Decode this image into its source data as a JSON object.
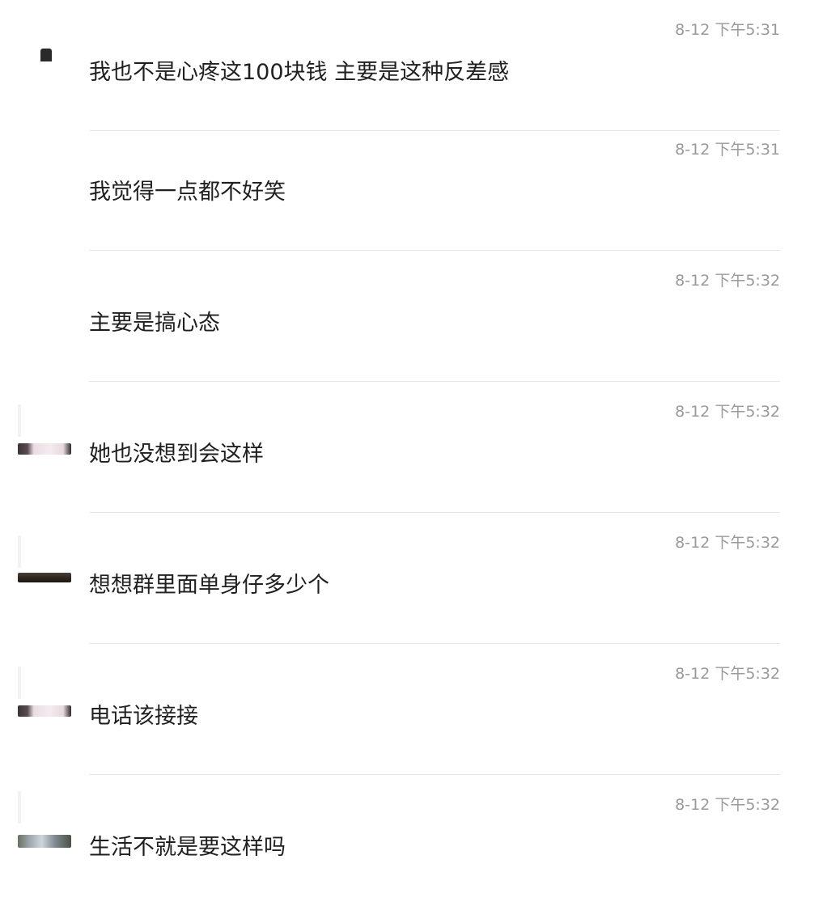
{
  "messages": [
    {
      "time": "8-12 下午5:31",
      "text": "我也不是心疼这100块钱 主要是这种反差感",
      "has_avatar": true
    },
    {
      "time": "8-12 下午5:31",
      "text": "我觉得一点都不好笑",
      "has_avatar": false
    },
    {
      "time": "8-12 下午5:32",
      "text": "主要是搞心态",
      "has_avatar": false
    },
    {
      "time": "8-12 下午5:32",
      "text": "她也没想到会这样",
      "has_avatar": true
    },
    {
      "time": "8-12 下午5:32",
      "text": "想想群里面单身仔多少个",
      "has_avatar": true
    },
    {
      "time": "8-12 下午5:32",
      "text": "电话该接接",
      "has_avatar": true
    },
    {
      "time": "8-12 下午5:32",
      "text": "生活不就是要这样吗",
      "has_avatar": true
    }
  ]
}
